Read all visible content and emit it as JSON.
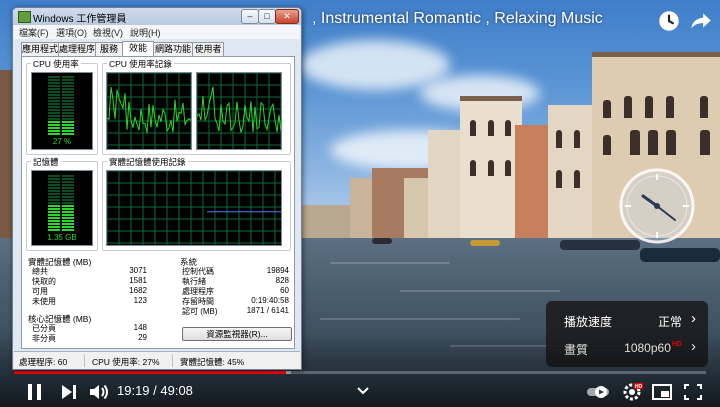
{
  "video": {
    "title": ", Instrumental Romantic , Relaxing Music",
    "current_time": "19:19",
    "duration": "49:08",
    "progress_fraction": 0.393,
    "buffer_fraction": 0.4,
    "time_display": "19:19 / 49:08"
  },
  "settings": {
    "rows": [
      {
        "label": "播放速度",
        "value": "正常"
      },
      {
        "label": "畫質",
        "value": "1080p60",
        "badge": "HD"
      }
    ]
  },
  "task_manager": {
    "title": "Windows 工作管理員",
    "menu": [
      "檔案(F)",
      "選項(O)",
      "檢視(V)",
      "說明(H)"
    ],
    "tabs": [
      "應用程式",
      "處理程序",
      "服務",
      "效能",
      "網路功能",
      "使用者"
    ],
    "active_tab": "效能",
    "cpu_usage": {
      "label": "CPU 使用率",
      "value": "27 %",
      "fraction": 0.27
    },
    "cpu_history": {
      "label": "CPU 使用率記錄"
    },
    "memory": {
      "label": "記憶體",
      "value": "1.35 GB",
      "fraction": 0.45
    },
    "memory_history": {
      "label": "實體記憶體使用記錄"
    },
    "physical_memory": {
      "header": "實體記憶體 (MB)",
      "rows": [
        {
          "k": "總共",
          "v": "3071"
        },
        {
          "k": "快取的",
          "v": "1581"
        },
        {
          "k": "可用",
          "v": "1682"
        },
        {
          "k": "未使用",
          "v": "123"
        }
      ]
    },
    "system": {
      "header": "系統",
      "rows": [
        {
          "k": "控制代碼",
          "v": "19894"
        },
        {
          "k": "執行緒",
          "v": "828"
        },
        {
          "k": "處理程序",
          "v": "60"
        },
        {
          "k": "存留時間",
          "v": "0:19:40:58"
        },
        {
          "k": "認可 (MB)",
          "v": "1871 / 6141"
        }
      ]
    },
    "kernel_memory": {
      "header": "核心記憶體 (MB)",
      "rows": [
        {
          "k": "已分頁",
          "v": "148"
        },
        {
          "k": "非分頁",
          "v": "29"
        }
      ]
    },
    "resource_monitor_button": "資源監視器(R)...",
    "status": {
      "processes": "處理程序: 60",
      "cpu": "CPU 使用率: 27%",
      "memory": "實體記憶體: 45%"
    }
  },
  "colors": {
    "accent_red": "#ff0000",
    "graph_green": "#2dd62d",
    "graph_grid": "#0a6a34",
    "memory_line": "#4d7bff"
  }
}
